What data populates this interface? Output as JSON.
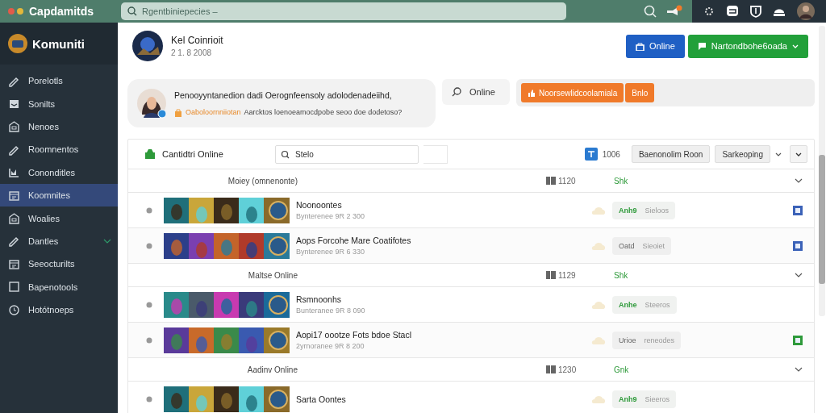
{
  "app": {
    "title": "Capdamitds",
    "search": {
      "placeholder": "Rgentbiniepecies –"
    }
  },
  "sidebar": {
    "brand": "Komuniti",
    "items": [
      {
        "label": "Porelotls",
        "selected": false
      },
      {
        "label": "Sonilts",
        "selected": false
      },
      {
        "label": "Nenoes",
        "selected": false
      },
      {
        "label": "Roomnentos",
        "selected": false
      },
      {
        "label": "Cononditles",
        "selected": false
      },
      {
        "label": "Koomnites",
        "selected": true
      },
      {
        "label": "Woalies",
        "selected": false
      },
      {
        "label": "Dantles",
        "selected": false,
        "expanded": false
      },
      {
        "label": "Seeocturilts",
        "selected": false
      },
      {
        "label": "Bapenotools",
        "selected": false
      },
      {
        "label": "Hotótnoeps",
        "selected": false
      }
    ]
  },
  "profile": {
    "name": "Kel Coinrioit",
    "date": "2 1. 8 2008"
  },
  "header_buttons": [
    {
      "label": "Online",
      "kind": "blue",
      "caret": false
    },
    {
      "label": "Nartondbohe6oada",
      "kind": "green",
      "caret": true
    }
  ],
  "post": {
    "text": "Penooyyntanedion dadi Oerognfeensoly adolodenadeiihd,",
    "tag": "Oaboloornniiotan",
    "text_2": "Aarcktos loenoeamocdpobe seoo doe dodetoso?"
  },
  "online_filter": {
    "label": "Online"
  },
  "actions": [
    {
      "label": "Noorsewlidcoolamiala",
      "icon": true
    },
    {
      "label": "Bnlo",
      "icon": false
    }
  ],
  "panel": {
    "title": "Cantidtri Online",
    "search": {
      "value": "Stelo"
    },
    "count": "1006",
    "buttons": [
      {
        "label": "Baenonolim Roon",
        "caret": false
      },
      {
        "label": "Sarkeoping",
        "caret": true
      }
    ],
    "groups": [
      {
        "title": "Moiey (omnenonte)",
        "count": "1120",
        "status": "Shk",
        "expanded": true,
        "rows": [
          {
            "name": "Noonoontes",
            "meta": "Bynterenee 9R 2 300",
            "tags": [
              "Anh9",
              "Sieloos"
            ],
            "active": true,
            "color": "#3b62b8"
          },
          {
            "name": "Aops Forcohe Mare Coatifotes",
            "meta": "Bynterenee 9R 6 330",
            "tags": [
              "Oatd",
              "Sieoiet"
            ],
            "active": false,
            "color": "#3b62b8"
          }
        ]
      },
      {
        "title": "Maltse Online",
        "count": "1129",
        "status": "Shk",
        "expanded": true,
        "rows": [
          {
            "name": "Rsmnoonhs",
            "meta": "Bunteranee 9R 8 090",
            "tags": [
              "Anhe",
              "Steeros"
            ],
            "active": true
          },
          {
            "name": "Aopi17 oootze Fots bdoe Stacl",
            "meta": "2yrnoranee 9R 8 200",
            "tags": [
              "Urioe",
              "reneodes"
            ],
            "active": false,
            "color": "#2e9a3a"
          }
        ]
      },
      {
        "title": "Aadinv Online",
        "count": "1230",
        "status": "Gnk",
        "expanded": true,
        "rows": [
          {
            "name": "Sarta Oontes",
            "tags": [
              "Anh9",
              "Sieeros"
            ],
            "active": true
          }
        ]
      }
    ]
  }
}
